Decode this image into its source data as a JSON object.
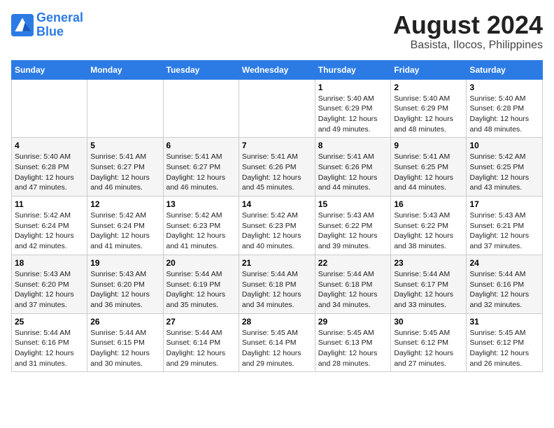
{
  "header": {
    "logo_line1": "General",
    "logo_line2": "Blue",
    "title": "August 2024",
    "subtitle": "Basista, Ilocos, Philippines"
  },
  "days_of_week": [
    "Sunday",
    "Monday",
    "Tuesday",
    "Wednesday",
    "Thursday",
    "Friday",
    "Saturday"
  ],
  "weeks": [
    [
      {
        "day": "",
        "info": ""
      },
      {
        "day": "",
        "info": ""
      },
      {
        "day": "",
        "info": ""
      },
      {
        "day": "",
        "info": ""
      },
      {
        "day": "1",
        "info": "Sunrise: 5:40 AM\nSunset: 6:29 PM\nDaylight: 12 hours\nand 49 minutes."
      },
      {
        "day": "2",
        "info": "Sunrise: 5:40 AM\nSunset: 6:29 PM\nDaylight: 12 hours\nand 48 minutes."
      },
      {
        "day": "3",
        "info": "Sunrise: 5:40 AM\nSunset: 6:28 PM\nDaylight: 12 hours\nand 48 minutes."
      }
    ],
    [
      {
        "day": "4",
        "info": "Sunrise: 5:40 AM\nSunset: 6:28 PM\nDaylight: 12 hours\nand 47 minutes."
      },
      {
        "day": "5",
        "info": "Sunrise: 5:41 AM\nSunset: 6:27 PM\nDaylight: 12 hours\nand 46 minutes."
      },
      {
        "day": "6",
        "info": "Sunrise: 5:41 AM\nSunset: 6:27 PM\nDaylight: 12 hours\nand 46 minutes."
      },
      {
        "day": "7",
        "info": "Sunrise: 5:41 AM\nSunset: 6:26 PM\nDaylight: 12 hours\nand 45 minutes."
      },
      {
        "day": "8",
        "info": "Sunrise: 5:41 AM\nSunset: 6:26 PM\nDaylight: 12 hours\nand 44 minutes."
      },
      {
        "day": "9",
        "info": "Sunrise: 5:41 AM\nSunset: 6:25 PM\nDaylight: 12 hours\nand 44 minutes."
      },
      {
        "day": "10",
        "info": "Sunrise: 5:42 AM\nSunset: 6:25 PM\nDaylight: 12 hours\nand 43 minutes."
      }
    ],
    [
      {
        "day": "11",
        "info": "Sunrise: 5:42 AM\nSunset: 6:24 PM\nDaylight: 12 hours\nand 42 minutes."
      },
      {
        "day": "12",
        "info": "Sunrise: 5:42 AM\nSunset: 6:24 PM\nDaylight: 12 hours\nand 41 minutes."
      },
      {
        "day": "13",
        "info": "Sunrise: 5:42 AM\nSunset: 6:23 PM\nDaylight: 12 hours\nand 41 minutes."
      },
      {
        "day": "14",
        "info": "Sunrise: 5:42 AM\nSunset: 6:23 PM\nDaylight: 12 hours\nand 40 minutes."
      },
      {
        "day": "15",
        "info": "Sunrise: 5:43 AM\nSunset: 6:22 PM\nDaylight: 12 hours\nand 39 minutes."
      },
      {
        "day": "16",
        "info": "Sunrise: 5:43 AM\nSunset: 6:22 PM\nDaylight: 12 hours\nand 38 minutes."
      },
      {
        "day": "17",
        "info": "Sunrise: 5:43 AM\nSunset: 6:21 PM\nDaylight: 12 hours\nand 37 minutes."
      }
    ],
    [
      {
        "day": "18",
        "info": "Sunrise: 5:43 AM\nSunset: 6:20 PM\nDaylight: 12 hours\nand 37 minutes."
      },
      {
        "day": "19",
        "info": "Sunrise: 5:43 AM\nSunset: 6:20 PM\nDaylight: 12 hours\nand 36 minutes."
      },
      {
        "day": "20",
        "info": "Sunrise: 5:44 AM\nSunset: 6:19 PM\nDaylight: 12 hours\nand 35 minutes."
      },
      {
        "day": "21",
        "info": "Sunrise: 5:44 AM\nSunset: 6:18 PM\nDaylight: 12 hours\nand 34 minutes."
      },
      {
        "day": "22",
        "info": "Sunrise: 5:44 AM\nSunset: 6:18 PM\nDaylight: 12 hours\nand 34 minutes."
      },
      {
        "day": "23",
        "info": "Sunrise: 5:44 AM\nSunset: 6:17 PM\nDaylight: 12 hours\nand 33 minutes."
      },
      {
        "day": "24",
        "info": "Sunrise: 5:44 AM\nSunset: 6:16 PM\nDaylight: 12 hours\nand 32 minutes."
      }
    ],
    [
      {
        "day": "25",
        "info": "Sunrise: 5:44 AM\nSunset: 6:16 PM\nDaylight: 12 hours\nand 31 minutes."
      },
      {
        "day": "26",
        "info": "Sunrise: 5:44 AM\nSunset: 6:15 PM\nDaylight: 12 hours\nand 30 minutes."
      },
      {
        "day": "27",
        "info": "Sunrise: 5:44 AM\nSunset: 6:14 PM\nDaylight: 12 hours\nand 29 minutes."
      },
      {
        "day": "28",
        "info": "Sunrise: 5:45 AM\nSunset: 6:14 PM\nDaylight: 12 hours\nand 29 minutes."
      },
      {
        "day": "29",
        "info": "Sunrise: 5:45 AM\nSunset: 6:13 PM\nDaylight: 12 hours\nand 28 minutes."
      },
      {
        "day": "30",
        "info": "Sunrise: 5:45 AM\nSunset: 6:12 PM\nDaylight: 12 hours\nand 27 minutes."
      },
      {
        "day": "31",
        "info": "Sunrise: 5:45 AM\nSunset: 6:12 PM\nDaylight: 12 hours\nand 26 minutes."
      }
    ]
  ]
}
